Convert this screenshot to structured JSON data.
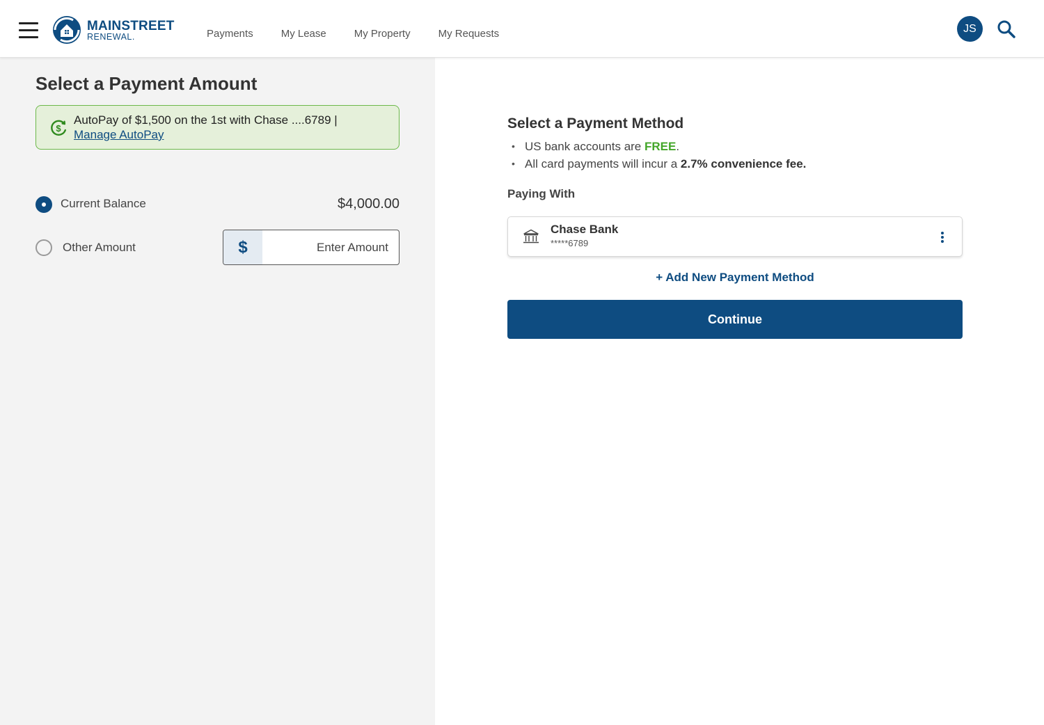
{
  "header": {
    "logo_line1": "MAINSTREET",
    "logo_line2": "RENEWAL.",
    "nav": [
      "Payments",
      "My Lease",
      "My Property",
      "My Requests"
    ],
    "avatar_initials": "JS"
  },
  "amount_panel": {
    "title": "Select a Payment Amount",
    "autopay_text": "AutoPay of $1,500 on the 1st with Chase ....6789 |",
    "autopay_link": "Manage AutoPay",
    "current_balance_label": "Current Balance",
    "current_balance_value": "$4,000.00",
    "current_balance_selected": true,
    "other_amount_label": "Other Amount",
    "other_amount_selected": false,
    "currency_symbol": "$",
    "amount_placeholder": "Enter Amount"
  },
  "method_panel": {
    "title": "Select a Payment Method",
    "bullet1_prefix": "US bank accounts are ",
    "bullet1_highlight": "FREE",
    "bullet1_suffix": ".",
    "bullet2_prefix": "All card payments will incur a ",
    "bullet2_highlight": "2.7% convenience fee.",
    "paying_with_label": "Paying With",
    "method": {
      "name": "Chase Bank",
      "account": "*****6789"
    },
    "add_method_label": "+ Add New Payment Method",
    "continue_label": "Continue"
  },
  "colors": {
    "brand": "#0e4c81",
    "free_green": "#43a629",
    "autopay_bg": "#e5f0da",
    "autopay_border": "#6cb84a",
    "left_bg": "#f3f3f3"
  }
}
